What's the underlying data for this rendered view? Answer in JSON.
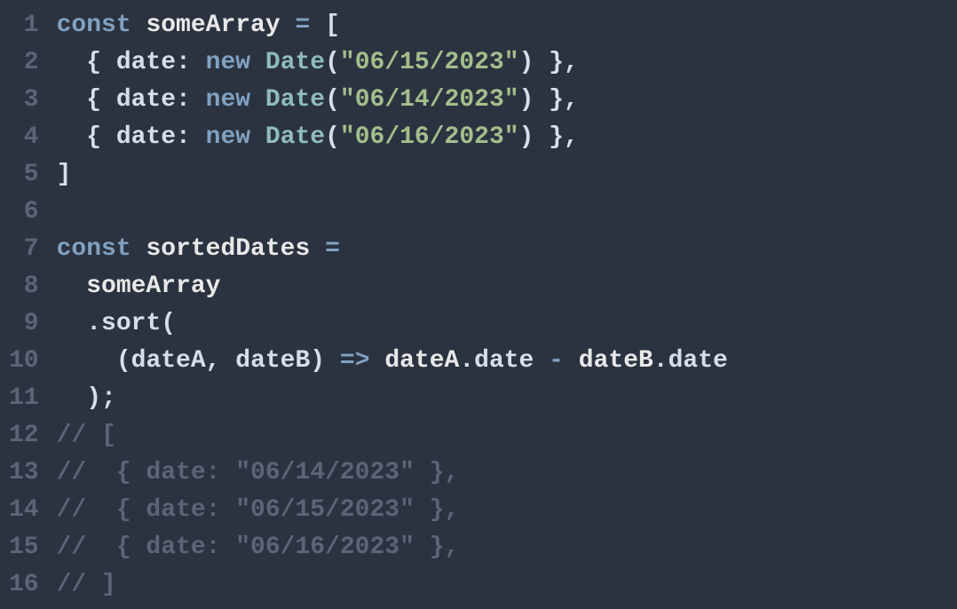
{
  "lines": [
    {
      "num": "1"
    },
    {
      "num": "2"
    },
    {
      "num": "3"
    },
    {
      "num": "4"
    },
    {
      "num": "5"
    },
    {
      "num": "6"
    },
    {
      "num": "7"
    },
    {
      "num": "8"
    },
    {
      "num": "9"
    },
    {
      "num": "10"
    },
    {
      "num": "11"
    },
    {
      "num": "12"
    },
    {
      "num": "13"
    },
    {
      "num": "14"
    },
    {
      "num": "15"
    },
    {
      "num": "16"
    }
  ],
  "tokens": {
    "const": "const",
    "someArray": "someArray",
    "eq": " = ",
    "openBracket": "[",
    "closeBracket": "]",
    "openBrace": "{ ",
    "closeBrace": " }",
    "date": "date",
    "colon": ": ",
    "new": "new",
    "Date": "Date",
    "openParen": "(",
    "closeParen": ")",
    "comma": ",",
    "semi": ";",
    "str1": "\"06/15/2023\"",
    "str2": "\"06/14/2023\"",
    "str3": "\"06/16/2023\"",
    "sortedDates": "sortedDates",
    "dot": ".",
    "sort": "sort",
    "dateA": "dateA",
    "dateB": "dateB",
    "commaSp": ", ",
    "arrow": " => ",
    "minus": " - ",
    "comment12": "// [",
    "comment13": "//  { date: \"06/14/2023\" },",
    "comment14": "//  { date: \"06/15/2023\" },",
    "comment15": "//  { date: \"06/16/2023\" },",
    "comment16": "// ]",
    "sp2": "  ",
    "sp4": "    ",
    "sp1": " "
  }
}
